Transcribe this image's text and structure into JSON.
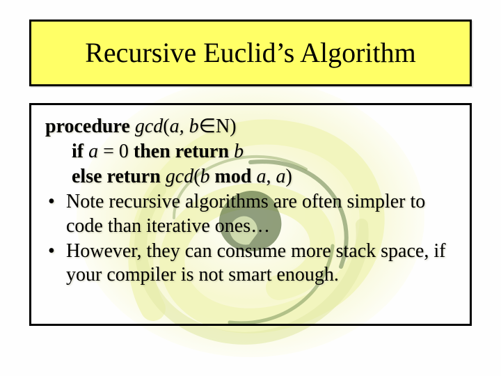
{
  "title": "Recursive Euclid’s Algorithm",
  "proc": {
    "kw_procedure": "procedure",
    "fn1": "gcd",
    "lparen1": "(",
    "args_ab": "a, b",
    "in_sym": "∈",
    "set_N": "N)",
    "kw_if": "if",
    "var_a": "a",
    "eq": " = 0 ",
    "kw_then_return": "then return",
    "var_b": " b",
    "kw_else_return": "else return",
    "fn2": " gcd",
    "lparen2": "(",
    "var_b2": "b",
    "kw_mod": " mod ",
    "var_a2": "a",
    "comma": ", ",
    "var_a3": "a",
    "rparen2": ")"
  },
  "bullets": [
    "Note recursive algorithms are often simpler to code than iterative ones…",
    "However, they can consume more stack space, if your compiler is not smart enough."
  ]
}
